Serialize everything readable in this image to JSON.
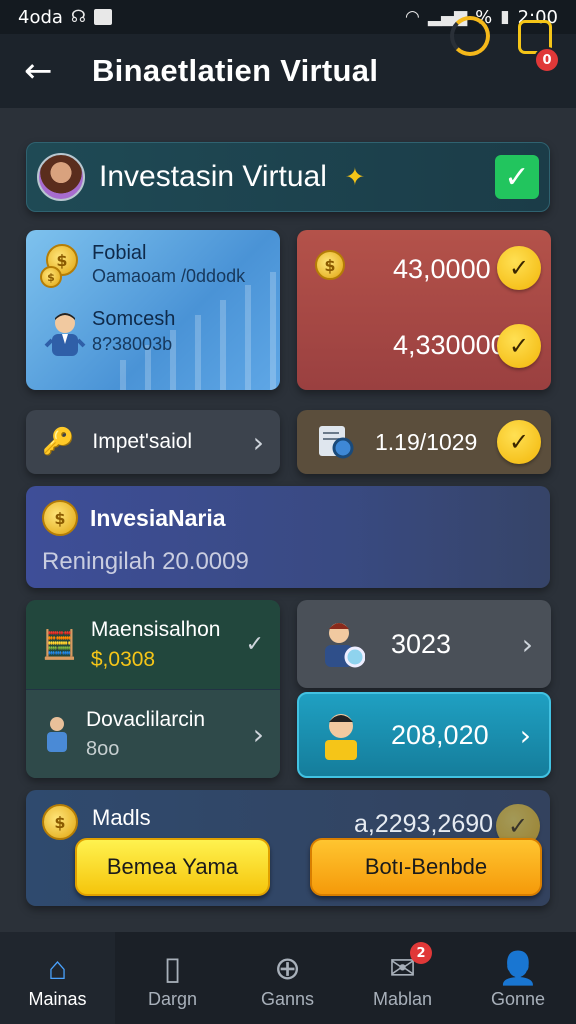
{
  "status_bar": {
    "carrier": "4oda",
    "battery_text": "%",
    "time": "2:00"
  },
  "header": {
    "title": "Binaetlatien Virtual",
    "notification_badge": "0"
  },
  "profile": {
    "name": "Investasin Virtual"
  },
  "balance_card": {
    "title": "Fobial",
    "subtitle": "Oamaoam /0ddodk",
    "title2": "Somcesh",
    "value2": "8?38003b"
  },
  "amount_card": {
    "amount1": "43,0000",
    "amount2": "4,330000"
  },
  "impersial": {
    "label": "Impet'saiol"
  },
  "counter": {
    "value": "1.19/1029"
  },
  "invest": {
    "title": "InvesiaNaria",
    "subtitle": "Reningilah 20.0009"
  },
  "green_panel": {
    "row1_title": "Maensisalhon",
    "row1_value": "$,0308",
    "row2_title": "Dovaclilarcin",
    "row2_value": "8oo"
  },
  "count_card": {
    "value": "3023"
  },
  "teal_card": {
    "value": "208,020"
  },
  "bottom_panel": {
    "title": "Madls",
    "amount": "a,2293,2690",
    "btn_left": "Bemea Yama",
    "btn_right": "Botı-Benbde"
  },
  "nav": {
    "items": [
      {
        "label": "Mainas",
        "icon": "home-icon"
      },
      {
        "label": "Dargn",
        "icon": "card-icon"
      },
      {
        "label": "Ganns",
        "icon": "plus-circle-icon"
      },
      {
        "label": "Mablan",
        "icon": "mail-icon"
      },
      {
        "label": "Gonne",
        "icon": "user-icon"
      }
    ],
    "badge": "2"
  },
  "colors": {
    "accent": "#f5c518",
    "profile_check": "#22c55e",
    "nav_active": "#4aa3ff"
  }
}
